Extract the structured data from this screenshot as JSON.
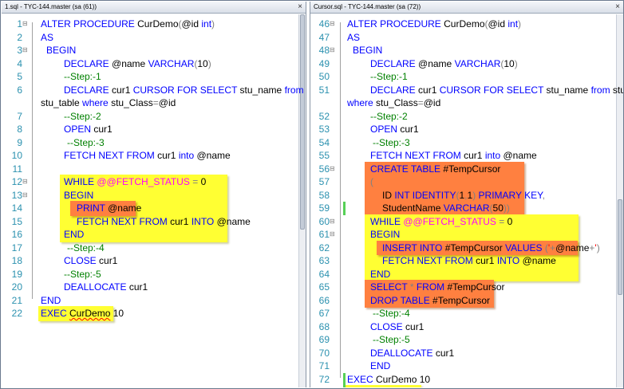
{
  "left": {
    "tab_title": "1.sql - TYC-144.master (sa (61))",
    "close_glyph": "×",
    "lines": [
      {
        "num": "1",
        "tokens": [
          {
            "t": "ALTER PROCEDURE ",
            "c": "kw"
          },
          {
            "t": "CurDemo",
            "c": "idt"
          },
          {
            "t": "(",
            "c": "op"
          },
          {
            "t": "@id ",
            "c": "idt"
          },
          {
            "t": "int",
            "c": "kw"
          },
          {
            "t": ")",
            "c": "op"
          }
        ]
      },
      {
        "num": "2",
        "tokens": [
          {
            "t": "AS",
            "c": "kw"
          }
        ]
      },
      {
        "num": "3",
        "tokens": [
          {
            "t": "BEGIN",
            "c": "kw"
          }
        ]
      },
      {
        "num": "4",
        "tokens": [
          {
            "t": "DECLARE ",
            "c": "kw"
          },
          {
            "t": "@name ",
            "c": "idt"
          },
          {
            "t": "VARCHAR",
            "c": "kw"
          },
          {
            "t": "(",
            "c": "op"
          },
          {
            "t": "10",
            "c": "idt"
          },
          {
            "t": ")",
            "c": "op"
          }
        ]
      },
      {
        "num": "5",
        "tokens": [
          {
            "t": "--Step:-1",
            "c": "cm"
          }
        ]
      },
      {
        "num": "6",
        "tokens": [
          {
            "t": "DECLARE ",
            "c": "kw"
          },
          {
            "t": "cur1 ",
            "c": "idt"
          },
          {
            "t": "CURSOR FOR SELECT ",
            "c": "kw"
          },
          {
            "t": "stu_name ",
            "c": "idt"
          },
          {
            "t": "from",
            "c": "kw"
          }
        ]
      },
      {
        "num": "",
        "tokens": [
          {
            "t": "stu_table ",
            "c": "idt"
          },
          {
            "t": "where ",
            "c": "kw"
          },
          {
            "t": "stu_Class",
            "c": "idt"
          },
          {
            "t": "=",
            "c": "op"
          },
          {
            "t": "@id",
            "c": "idt"
          }
        ]
      },
      {
        "num": "7",
        "tokens": [
          {
            "t": "--Step:-2",
            "c": "cm"
          }
        ]
      },
      {
        "num": "8",
        "tokens": [
          {
            "t": "OPEN ",
            "c": "kw"
          },
          {
            "t": "cur1",
            "c": "idt"
          }
        ]
      },
      {
        "num": "9",
        "tokens": [
          {
            "t": "--Step:-3",
            "c": "cm"
          }
        ]
      },
      {
        "num": "10",
        "tokens": [
          {
            "t": "FETCH NEXT FROM ",
            "c": "kw"
          },
          {
            "t": "cur1 ",
            "c": "idt"
          },
          {
            "t": "into ",
            "c": "kw"
          },
          {
            "t": "@name",
            "c": "idt"
          }
        ]
      },
      {
        "num": "11",
        "tokens": []
      },
      {
        "num": "12",
        "tokens": [
          {
            "t": "WHILE ",
            "c": "kw"
          },
          {
            "t": "@@FETCH_STATUS",
            "c": "sys"
          },
          {
            "t": " = ",
            "c": "op"
          },
          {
            "t": "0",
            "c": "idt"
          }
        ]
      },
      {
        "num": "13",
        "tokens": [
          {
            "t": "BEGIN",
            "c": "kw"
          }
        ]
      },
      {
        "num": "14",
        "tokens": [
          {
            "t": "PRINT ",
            "c": "kw"
          },
          {
            "t": "@name",
            "c": "idt"
          }
        ]
      },
      {
        "num": "15",
        "tokens": [
          {
            "t": "FETCH NEXT FROM ",
            "c": "kw"
          },
          {
            "t": "cur1 ",
            "c": "idt"
          },
          {
            "t": "INTO ",
            "c": "kw"
          },
          {
            "t": "@name",
            "c": "idt"
          }
        ]
      },
      {
        "num": "16",
        "tokens": [
          {
            "t": "END",
            "c": "kw"
          }
        ]
      },
      {
        "num": "17",
        "tokens": [
          {
            "t": "--Step:-4",
            "c": "cm"
          }
        ]
      },
      {
        "num": "18",
        "tokens": [
          {
            "t": "CLOSE ",
            "c": "kw"
          },
          {
            "t": "cur1",
            "c": "idt"
          }
        ]
      },
      {
        "num": "19",
        "tokens": [
          {
            "t": "--Step:-5",
            "c": "cm"
          }
        ]
      },
      {
        "num": "20",
        "tokens": [
          {
            "t": "DEALLOCATE ",
            "c": "kw"
          },
          {
            "t": "cur1",
            "c": "idt"
          }
        ]
      },
      {
        "num": "21",
        "tokens": [
          {
            "t": "END",
            "c": "kw"
          }
        ]
      },
      {
        "num": "22",
        "tokens": [
          {
            "t": "EXEC ",
            "c": "kw"
          },
          {
            "t": "CurDemo",
            "c": "idt sq"
          },
          {
            "t": " 10",
            "c": "idt"
          }
        ]
      }
    ]
  },
  "right": {
    "tab_title": "Cursor.sql - TYC-144.master (sa (72))",
    "close_glyph": "×",
    "lines": [
      {
        "num": "46",
        "tokens": [
          {
            "t": "ALTER PROCEDURE ",
            "c": "kw"
          },
          {
            "t": "CurDemo",
            "c": "idt"
          },
          {
            "t": "(",
            "c": "op"
          },
          {
            "t": "@id ",
            "c": "idt"
          },
          {
            "t": "int",
            "c": "kw"
          },
          {
            "t": ")",
            "c": "op"
          }
        ]
      },
      {
        "num": "47",
        "tokens": [
          {
            "t": "AS",
            "c": "kw"
          }
        ]
      },
      {
        "num": "48",
        "tokens": [
          {
            "t": "BEGIN",
            "c": "kw"
          }
        ]
      },
      {
        "num": "49",
        "tokens": [
          {
            "t": "DECLARE ",
            "c": "kw"
          },
          {
            "t": "@name ",
            "c": "idt"
          },
          {
            "t": "VARCHAR",
            "c": "kw"
          },
          {
            "t": "(",
            "c": "op"
          },
          {
            "t": "10",
            "c": "idt"
          },
          {
            "t": ")",
            "c": "op"
          }
        ]
      },
      {
        "num": "50",
        "tokens": [
          {
            "t": "--Step:-1",
            "c": "cm"
          }
        ]
      },
      {
        "num": "51",
        "tokens": [
          {
            "t": "DECLARE ",
            "c": "kw"
          },
          {
            "t": "cur1 ",
            "c": "idt"
          },
          {
            "t": "CURSOR FOR SELECT ",
            "c": "kw"
          },
          {
            "t": "stu_name ",
            "c": "idt"
          },
          {
            "t": "from ",
            "c": "kw"
          },
          {
            "t": "stu_table",
            "c": "idt"
          }
        ]
      },
      {
        "num": "",
        "tokens": [
          {
            "t": "where ",
            "c": "kw"
          },
          {
            "t": "stu_Class",
            "c": "idt"
          },
          {
            "t": "=",
            "c": "op"
          },
          {
            "t": "@id",
            "c": "idt"
          }
        ]
      },
      {
        "num": "52",
        "tokens": [
          {
            "t": "--Step:-2",
            "c": "cm"
          }
        ]
      },
      {
        "num": "53",
        "tokens": [
          {
            "t": "OPEN ",
            "c": "kw"
          },
          {
            "t": "cur1",
            "c": "idt"
          }
        ]
      },
      {
        "num": "54",
        "tokens": [
          {
            "t": "--Step:-3",
            "c": "cm"
          }
        ]
      },
      {
        "num": "55",
        "tokens": [
          {
            "t": "FETCH NEXT FROM ",
            "c": "kw"
          },
          {
            "t": "cur1 ",
            "c": "idt"
          },
          {
            "t": "into ",
            "c": "kw"
          },
          {
            "t": "@name",
            "c": "idt"
          }
        ]
      },
      {
        "num": "56",
        "tokens": [
          {
            "t": "CREATE TABLE ",
            "c": "kw"
          },
          {
            "t": "#TempCursor",
            "c": "idt"
          }
        ]
      },
      {
        "num": "57",
        "tokens": [
          {
            "t": "(",
            "c": "op"
          }
        ]
      },
      {
        "num": "58",
        "tokens": [
          {
            "t": "ID ",
            "c": "idt"
          },
          {
            "t": "INT IDENTITY",
            "c": "kw"
          },
          {
            "t": "(",
            "c": "op"
          },
          {
            "t": "1",
            "c": "idt"
          },
          {
            "t": ",",
            "c": "op"
          },
          {
            "t": "1",
            "c": "idt"
          },
          {
            "t": ") ",
            "c": "op"
          },
          {
            "t": "PRIMARY KEY",
            "c": "kw"
          },
          {
            "t": ",",
            "c": "op"
          }
        ]
      },
      {
        "num": "59",
        "tokens": [
          {
            "t": "StudentName ",
            "c": "idt"
          },
          {
            "t": "VARCHAR",
            "c": "kw"
          },
          {
            "t": "(",
            "c": "op"
          },
          {
            "t": "50",
            "c": "idt"
          },
          {
            "t": "))",
            "c": "op"
          }
        ]
      },
      {
        "num": "60",
        "tokens": [
          {
            "t": "WHILE ",
            "c": "kw"
          },
          {
            "t": "@@FETCH_STATUS",
            "c": "sys"
          },
          {
            "t": " = ",
            "c": "op"
          },
          {
            "t": "0",
            "c": "idt"
          }
        ]
      },
      {
        "num": "61",
        "tokens": [
          {
            "t": "BEGIN",
            "c": "kw"
          }
        ]
      },
      {
        "num": "62",
        "tokens": [
          {
            "t": "INSERT INTO ",
            "c": "kw"
          },
          {
            "t": "#TempCursor ",
            "c": "idt"
          },
          {
            "t": "VALUES ",
            "c": "kw"
          },
          {
            "t": "(",
            "c": "op"
          },
          {
            "t": "'",
            "c": "str"
          },
          {
            "t": "+",
            "c": "op"
          },
          {
            "t": "@name",
            "c": "idt"
          },
          {
            "t": "+",
            "c": "op"
          },
          {
            "t": "'",
            "c": "str"
          },
          {
            "t": ")",
            "c": "op"
          }
        ]
      },
      {
        "num": "63",
        "tokens": [
          {
            "t": "FETCH NEXT FROM ",
            "c": "kw"
          },
          {
            "t": "cur1 ",
            "c": "idt"
          },
          {
            "t": "INTO ",
            "c": "kw"
          },
          {
            "t": "@name",
            "c": "idt"
          }
        ]
      },
      {
        "num": "64",
        "tokens": [
          {
            "t": "END",
            "c": "kw"
          }
        ]
      },
      {
        "num": "65",
        "tokens": [
          {
            "t": "SELECT  ",
            "c": "kw"
          },
          {
            "t": "* ",
            "c": "op"
          },
          {
            "t": "FROM ",
            "c": "kw"
          },
          {
            "t": "#TempCursor",
            "c": "idt"
          }
        ]
      },
      {
        "num": "66",
        "tokens": [
          {
            "t": "DROP TABLE   ",
            "c": "kw"
          },
          {
            "t": "#TempCursor",
            "c": "idt"
          }
        ]
      },
      {
        "num": "67",
        "tokens": [
          {
            "t": "--Step:-4",
            "c": "cm"
          }
        ]
      },
      {
        "num": "68",
        "tokens": [
          {
            "t": "CLOSE ",
            "c": "kw"
          },
          {
            "t": "cur1",
            "c": "idt"
          }
        ]
      },
      {
        "num": "69",
        "tokens": [
          {
            "t": "--Step:-5",
            "c": "cm"
          }
        ]
      },
      {
        "num": "70",
        "tokens": [
          {
            "t": "DEALLOCATE ",
            "c": "kw"
          },
          {
            "t": "cur1",
            "c": "idt"
          }
        ]
      },
      {
        "num": "71",
        "tokens": [
          {
            "t": "END",
            "c": "kw"
          }
        ]
      },
      {
        "num": "72",
        "tokens": [
          {
            "t": "EXEC ",
            "c": "kw"
          },
          {
            "t": "CurDemo",
            "c": "idt"
          },
          {
            "t": " 10",
            "c": "idt"
          }
        ]
      }
    ]
  },
  "colors": {
    "keyword": "#0000ff",
    "comment": "#008000",
    "system_function": "#ff00ff",
    "operator": "#808080",
    "string": "#ff0000",
    "line_number": "#2b91af",
    "highlight_yellow": "#ffff33",
    "highlight_orange": "#ff8040"
  }
}
